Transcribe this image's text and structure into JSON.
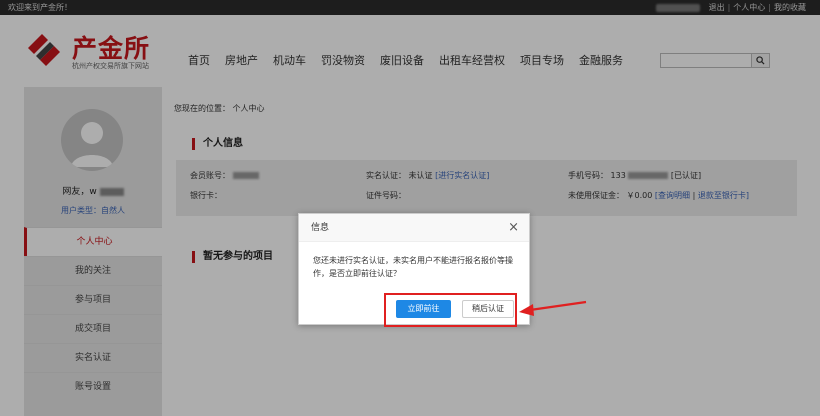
{
  "topbar": {
    "welcome": "欢迎来到产金所！",
    "logout": "退出",
    "user_center": "个人中心",
    "favorites": "我的收藏",
    "separator": "|"
  },
  "header": {
    "logo_title": "产金所",
    "logo_subtitle": "杭州产权交易所旗下网站",
    "nav": [
      "首页",
      "房地产",
      "机动车",
      "罚没物资",
      "废旧设备",
      "出租车经营权",
      "项目专场",
      "金融服务"
    ],
    "search_icon": "search-icon"
  },
  "sidebar": {
    "username_label": "网友，w",
    "usertype_label": "用户类型：自然人",
    "menu": [
      "个人中心",
      "我的关注",
      "参与项目",
      "成交项目",
      "实名认证",
      "账号设置"
    ]
  },
  "main": {
    "breadcrumb": "您现在的位置： 个人中心",
    "section_personal": "个人信息",
    "section_projects": "暂无参与的项目",
    "info": {
      "account_label": "会员账号：",
      "realname_label": "实名认证：",
      "realname_status": "未认证",
      "realname_link": "[进行实名认证]",
      "phone_label": "手机号码：",
      "phone_prefix": "133",
      "phone_status": "[已认证]",
      "bank_label": "银行卡：",
      "cert_label": "证件号码：",
      "deposit_label": "未使用保证金：",
      "deposit_value": "￥0.00",
      "deposit_link1": "[查询明细",
      "deposit_sep": "|",
      "deposit_link2": "退款至银行卡]"
    }
  },
  "dialog": {
    "title": "信息",
    "close_icon": "×",
    "message": "您还未进行实名认证，未实名用户不能进行报名报价等操作，是否立即前往认证？",
    "confirm": "立即前往",
    "cancel": "稍后认证"
  },
  "colors": {
    "brand_red": "#c8171c",
    "topbar": "#2b2b2b",
    "primary_blue": "#1e88e5",
    "annotation_red": "#e02020"
  }
}
